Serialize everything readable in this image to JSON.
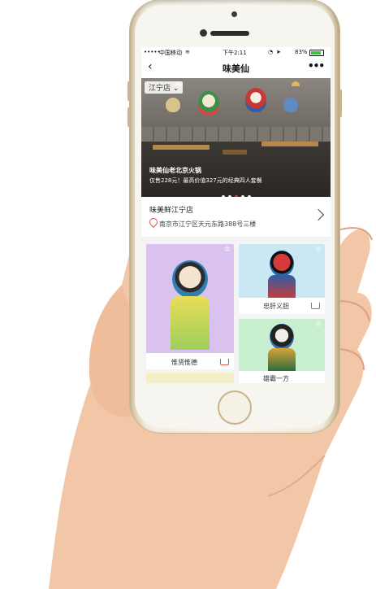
{
  "status_bar": {
    "carrier": "中国移动",
    "time": "下午2:11",
    "battery": "83%"
  },
  "nav": {
    "back_icon": "chevron-left-icon",
    "title": "味美仙",
    "more_icon": "more-dots-icon"
  },
  "banner": {
    "city_tag": "江宁店",
    "title": "味美仙老北京火锅",
    "subtitle": "仅售228元！最高价值327元的经典四人套餐",
    "active_dot": 3,
    "dot_count": 5
  },
  "store": {
    "name": "味美鲜江宁店",
    "address": "南京市江宁区天元东路388号三楼"
  },
  "products": [
    {
      "label": "惟贤惟德",
      "bg": "#d9c2ef"
    },
    {
      "label": "忠肝义胆",
      "bg": "#c9e8f4"
    },
    {
      "label": "",
      "bg": "#f3efc6"
    },
    {
      "label": "雄霸一方",
      "bg": "#c8efd0"
    }
  ],
  "colors": {
    "accent": "#e2544b",
    "phone_gold": "#d8c59d"
  }
}
